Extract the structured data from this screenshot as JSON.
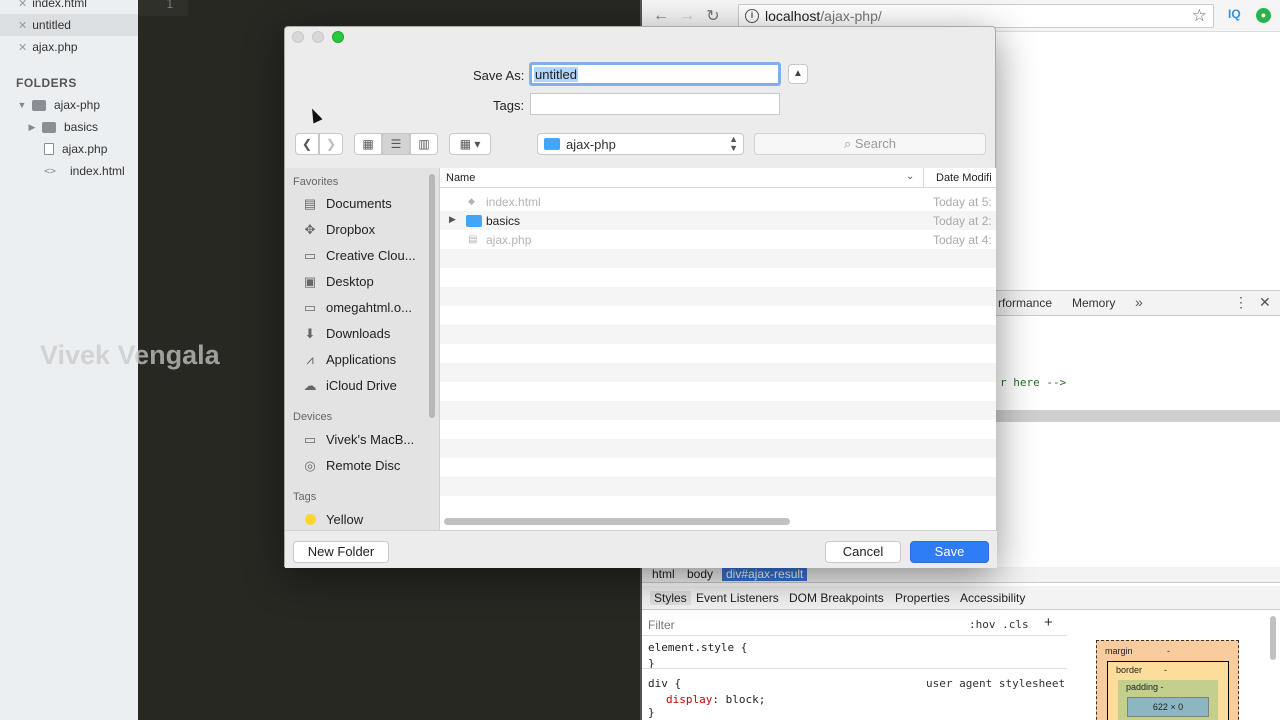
{
  "editor": {
    "open_files": [
      "index.html",
      "untitled",
      "ajax.php"
    ],
    "folders_heading": "FOLDERS",
    "tree": [
      {
        "label": "ajax-php",
        "kind": "folder-open"
      },
      {
        "label": "basics",
        "kind": "folder"
      },
      {
        "label": "ajax.php",
        "kind": "file"
      },
      {
        "label": "index.html",
        "kind": "code-file"
      }
    ],
    "line_number": "1",
    "watermark": "Vivek Vengala"
  },
  "browser": {
    "url_host": "localhost",
    "url_path": "/ajax-php/",
    "extension_label": "IQ",
    "devtools_tabs": [
      "rformance",
      "Memory"
    ],
    "more_tabs_icon": "»",
    "element_snippet": "r here -->",
    "breadcrumbs": [
      "html",
      "body",
      "div#ajax-result"
    ],
    "styles_tabs": [
      "Styles",
      "Event Listeners",
      "DOM Breakpoints",
      "Properties",
      "Accessibility"
    ],
    "filter_placeholder": "Filter",
    "filter_buttons": ":hov .cls",
    "css_lines": {
      "element_style_open": "element.style {",
      "element_style_close": "}",
      "div_open": "div {",
      "prop": "display",
      "value": ": block;",
      "div_close": "}"
    },
    "ua_label": "user agent stylesheet",
    "box_model": {
      "margin": "margin",
      "border": "border",
      "padding": "padding -",
      "content": "622 × 0",
      "dash": "-"
    }
  },
  "dialog": {
    "save_as_label": "Save As:",
    "save_as_value": "untitled",
    "tags_label": "Tags:",
    "location": "ajax-php",
    "search_placeholder": "Search",
    "sidebar": {
      "favorites_heading": "Favorites",
      "favorites": [
        {
          "label": "Documents",
          "icon": "documents-icon"
        },
        {
          "label": "Dropbox",
          "icon": "dropbox-icon"
        },
        {
          "label": "Creative Clou...",
          "icon": "folder-icon"
        },
        {
          "label": "Desktop",
          "icon": "desktop-icon"
        },
        {
          "label": "omegahtml.o...",
          "icon": "folder-icon"
        },
        {
          "label": "Downloads",
          "icon": "downloads-icon"
        },
        {
          "label": "Applications",
          "icon": "applications-icon"
        },
        {
          "label": "iCloud Drive",
          "icon": "cloud-icon"
        }
      ],
      "devices_heading": "Devices",
      "devices": [
        {
          "label": "Vivek's MacB...",
          "icon": "laptop-icon"
        },
        {
          "label": "Remote Disc",
          "icon": "disc-icon"
        }
      ],
      "tags_heading": "Tags",
      "tags": [
        {
          "label": "Yellow",
          "color": "#ffd52e"
        }
      ]
    },
    "columns": {
      "name": "Name",
      "date": "Date Modifi"
    },
    "files": [
      {
        "name": "index.html",
        "date": "Today at 5:",
        "kind": "file",
        "enabled": false
      },
      {
        "name": "basics",
        "date": "Today at 2:",
        "kind": "folder",
        "enabled": true
      },
      {
        "name": "ajax.php",
        "date": "Today at 4:",
        "kind": "file",
        "enabled": false
      }
    ],
    "buttons": {
      "new_folder": "New Folder",
      "cancel": "Cancel",
      "save": "Save"
    },
    "accent_color": "#2e7cf6"
  }
}
